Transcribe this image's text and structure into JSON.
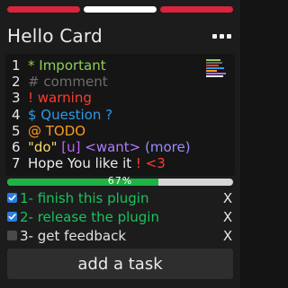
{
  "tabs": [
    {
      "color": "#d9243d"
    },
    {
      "color": "#ffffff"
    },
    {
      "color": "#d9243d"
    }
  ],
  "card": {
    "title": "Hello Card",
    "menu_icon": "more-horizontal-icon"
  },
  "note": {
    "lines": [
      {
        "n": "1",
        "segments": [
          {
            "text": "* Important",
            "cls": "c-green"
          }
        ]
      },
      {
        "n": "2",
        "segments": [
          {
            "text": "# comment",
            "cls": "c-grey"
          }
        ]
      },
      {
        "n": "3",
        "segments": [
          {
            "text": "! warning",
            "cls": "c-red"
          }
        ]
      },
      {
        "n": "4",
        "segments": [
          {
            "text": "$ Question ?",
            "cls": "c-blue"
          }
        ]
      },
      {
        "n": "5",
        "segments": [
          {
            "text": "@ TODO",
            "cls": "c-orange"
          }
        ]
      },
      {
        "n": "6",
        "segments": [
          {
            "text": "\"do\" ",
            "cls": "c-yellow"
          },
          {
            "text": "[u] ",
            "cls": "c-purple"
          },
          {
            "text": "<want> ",
            "cls": "c-violet"
          },
          {
            "text": "(more)",
            "cls": "c-lavender"
          }
        ]
      },
      {
        "n": "7",
        "segments": [
          {
            "text": "Hope You like it ",
            "cls": "c-white"
          },
          {
            "text": "! <3",
            "cls": "c-red"
          }
        ]
      }
    ]
  },
  "progress": {
    "value": 0.67,
    "label": "67%"
  },
  "tasks": [
    {
      "label": "1- finish this plugin",
      "done": true,
      "remove": "X"
    },
    {
      "label": "2- release the plugin",
      "done": true,
      "remove": "X"
    },
    {
      "label": "3- get feedback",
      "done": false,
      "remove": "X"
    }
  ],
  "add_task_label": "add a task"
}
